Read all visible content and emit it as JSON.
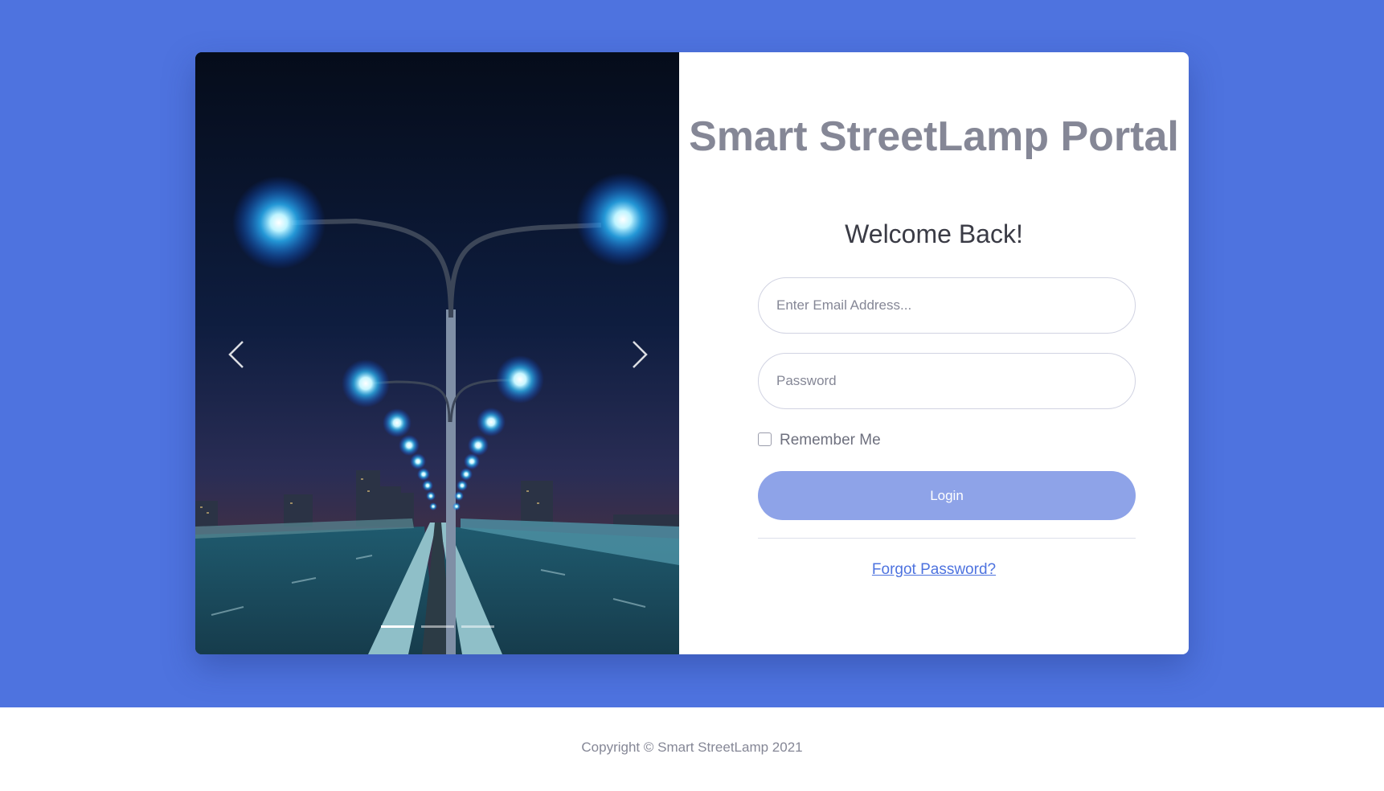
{
  "page": {
    "background_color": "#4e73df",
    "footer_background_color": "#ffffff"
  },
  "carousel": {
    "image_description_icon": "night-bridge-streetlamps-image",
    "prev_icon": "chevron-left-icon",
    "next_icon": "chevron-right-icon",
    "slide_count": 3,
    "active_slide": 1
  },
  "login_form": {
    "title": "Smart StreetLamp Portal",
    "subtitle": "Welcome Back!",
    "email_placeholder": "Enter Email Address...",
    "email_value": "",
    "password_placeholder": "Password",
    "password_value": "",
    "remember_label": "Remember Me",
    "remember_checked": false,
    "login_label": "Login",
    "login_button_color": "#8ea3e8",
    "forgot_label": "Forgot Password?",
    "link_color": "#4e73df"
  },
  "footer": {
    "copyright": "Copyright © Smart StreetLamp 2021"
  }
}
